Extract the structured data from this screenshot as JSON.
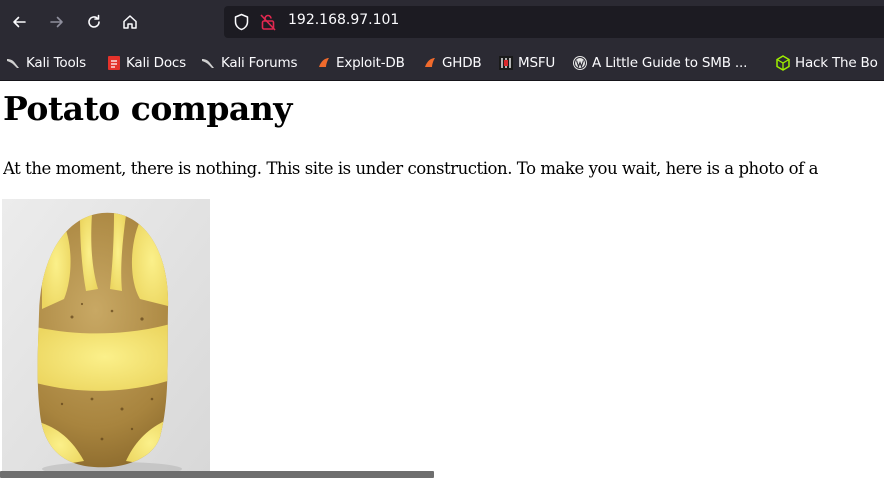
{
  "browser": {
    "url": "192.168.97.101",
    "bookmarks": [
      {
        "label": "Kali Tools",
        "icon": "kali-dragon-icon"
      },
      {
        "label": "Kali Docs",
        "icon": "kali-docs-icon"
      },
      {
        "label": "Kali Forums",
        "icon": "kali-dragon-icon"
      },
      {
        "label": "Exploit-DB",
        "icon": "exploit-db-icon"
      },
      {
        "label": "GHDB",
        "icon": "exploit-db-icon"
      },
      {
        "label": "MSFU",
        "icon": "msfu-icon"
      },
      {
        "label": "A Little Guide to SMB ...",
        "icon": "wordpress-icon"
      },
      {
        "label": "Hack The Bo",
        "icon": "hackthebox-icon"
      }
    ]
  },
  "page": {
    "heading": "Potato company",
    "paragraph": "At the moment, there is nothing. This site is under construction. To make you wait, here is a photo of a"
  },
  "colors": {
    "chrome_bg": "#2b2a33",
    "urlbar_bg": "#1c1b22",
    "chrome_text": "#fbfbfe",
    "lock_red": "#e22850"
  }
}
